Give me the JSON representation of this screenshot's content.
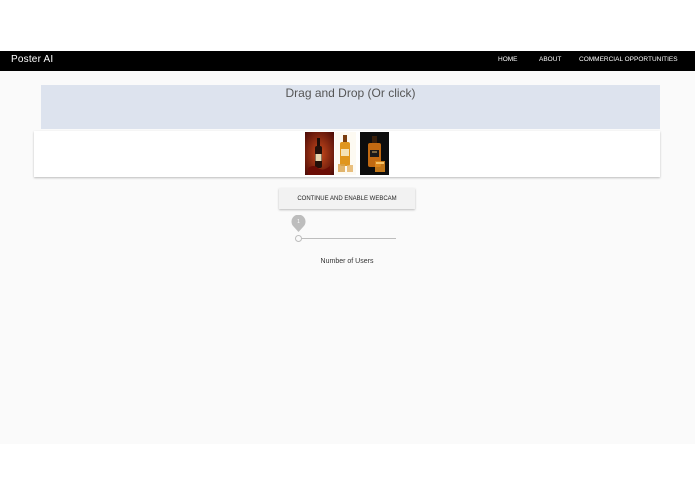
{
  "navbar": {
    "brand": "Poster AI",
    "links": [
      "HOME",
      "ABOUT",
      "COMMERCIAL OPPORTUNITIES"
    ]
  },
  "dropzone": {
    "label": "Drag and Drop (Or click)"
  },
  "previews": [
    "wine-bottle-image",
    "whisky-bottle-image",
    "whisky-bottle-dark-image"
  ],
  "continue_button": {
    "label": "CONTINUE AND ENABLE WEBCAM"
  },
  "users_slider": {
    "value": "1",
    "label": "Number of Users",
    "min_fraction": 0
  },
  "colors": {
    "navbar": "#000000",
    "dropzone": "#dde3ee",
    "background": "#fafafa",
    "slider_bubble": "#bdbdbd"
  }
}
